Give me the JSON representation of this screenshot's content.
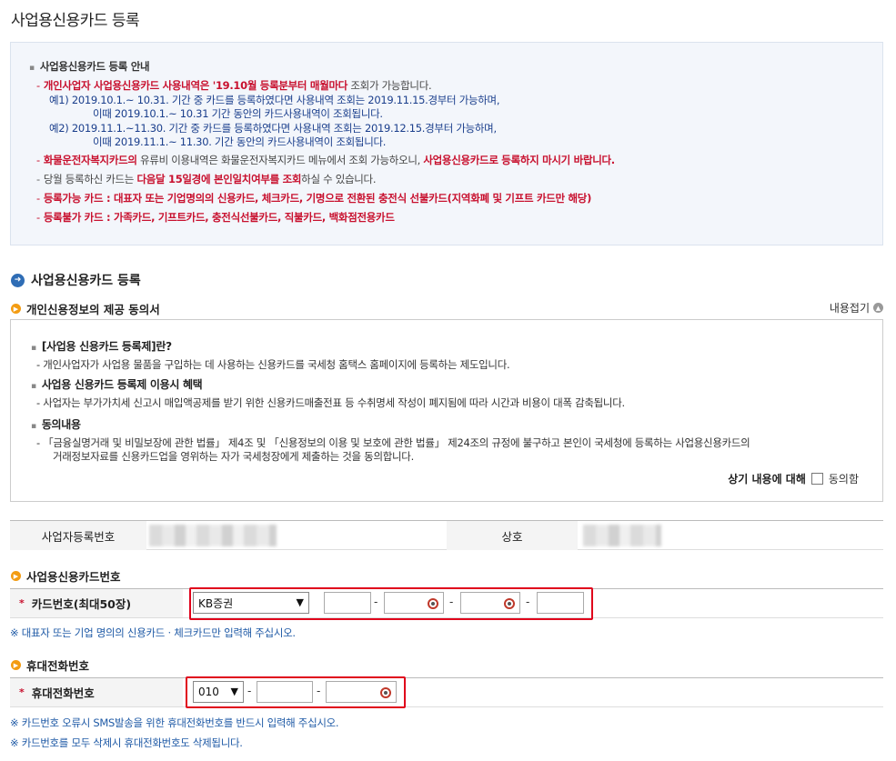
{
  "page_title": "사업용신용카드 등록",
  "notice": {
    "heading": "사업용신용카드 등록 안내",
    "line1_red": "개인사업자 사업용신용카드 사용내역은 '19.10월 등록분부터 매월마다",
    "line1_plain": " 조회가 가능합니다.",
    "ex1_a": "예1) 2019.10.1.~ 10.31. 기간 중 카드를 등록하였다면 사용내역 조회는 2019.11.15.경부터 가능하며,",
    "ex1_b": "이때 2019.10.1.~ 10.31 기간 동안의 카드사용내역이 조회됩니다.",
    "ex2_a": "예2) 2019.11.1.~11.30. 기간 중 카드를 등록하였다면 사용내역 조회는 2019.12.15.경부터 가능하며,",
    "ex2_b": "이때 2019.11.1.~ 11.30. 기간 동안의 카드사용내역이 조회됩니다.",
    "line2_red1": "화물운전자복지카드의",
    "line2_plain": " 유류비 이용내역은 화물운전자복지카드 메뉴에서 조회 가능하오니, ",
    "line2_red2": "사업용신용카드로 등록하지 마시기 바랍니다.",
    "line3_plain1": "당월 등록하신 카드는 ",
    "line3_red": "다음달 15일경에 본인일치여부를 조회",
    "line3_plain2": "하실 수 있습니다.",
    "line4": "등록가능 카드 : 대표자 또는 기업명의의 신용카드, 체크카드, 기명으로 전환된 충전식 선불카드(지역화폐 및 기프트 카드만 해당)",
    "line5": "등록불가 카드 : 가족카드, 기프트카드, 충전식선불카드, 직불카드, 백화점전용카드"
  },
  "section_title": "사업용신용카드 등록",
  "consent": {
    "title": "개인신용정보의 제공 동의서",
    "collapse_label": "내용접기",
    "h1": "[사업용 신용카드 등록제]란?",
    "t1": "- 개인사업자가 사업용 물품을 구입하는 데 사용하는 신용카드를 국세청 홈택스 홈페이지에 등록하는 제도입니다.",
    "h2": "사업용 신용카드 등록제 이용시 혜택",
    "t2": "- 사업자는 부가가치세 신고시 매입액공제를 받기 위한 신용카드매출전표 등 수취명세 작성이 폐지됨에 따라 시간과 비용이 대폭 감축됩니다.",
    "h3": "동의내용",
    "t3a": "- 「금융실명거래 및 비밀보장에 관한 법률」 제4조 및 「신용정보의 이용 및 보호에 관한 법률」 제24조의 규정에 불구하고 본인이 국세청에 등록하는 사업용신용카드의",
    "t3b": "거래정보자료를 신용카드업을 영위하는 자가 국세청장에게 제출하는 것을 동의합니다.",
    "agree_label": "상기 내용에 대해",
    "agree_checkbox_label": "동의함"
  },
  "business": {
    "reg_no_label": "사업자등록번호",
    "name_label": "상호"
  },
  "card": {
    "section_label": "사업용신용카드번호",
    "row_label": "카드번호(최대50장)",
    "selected_company": "KB증권",
    "separator": "-",
    "note": "※ 대표자 또는 기업 명의의 신용카드ㆍ체크카드만 입력해 주십시오."
  },
  "phone": {
    "section_label": "휴대전화번호",
    "row_label": "휴대전화번호",
    "selected_prefix": "010",
    "separator": "-",
    "note1": "※ 카드번호 오류시 SMS발송을 위한 휴대전화번호를 반드시 입력해 주십시오.",
    "note2": "※ 카드번호를 모두 삭제시 휴대전화번호도 삭제됩니다."
  },
  "required_mark": "*",
  "icons": {
    "section": "circle-arrow-icon",
    "sub": "orange-dot-icon",
    "collapse": "chevron-up-icon",
    "masked": "eye-icon"
  }
}
